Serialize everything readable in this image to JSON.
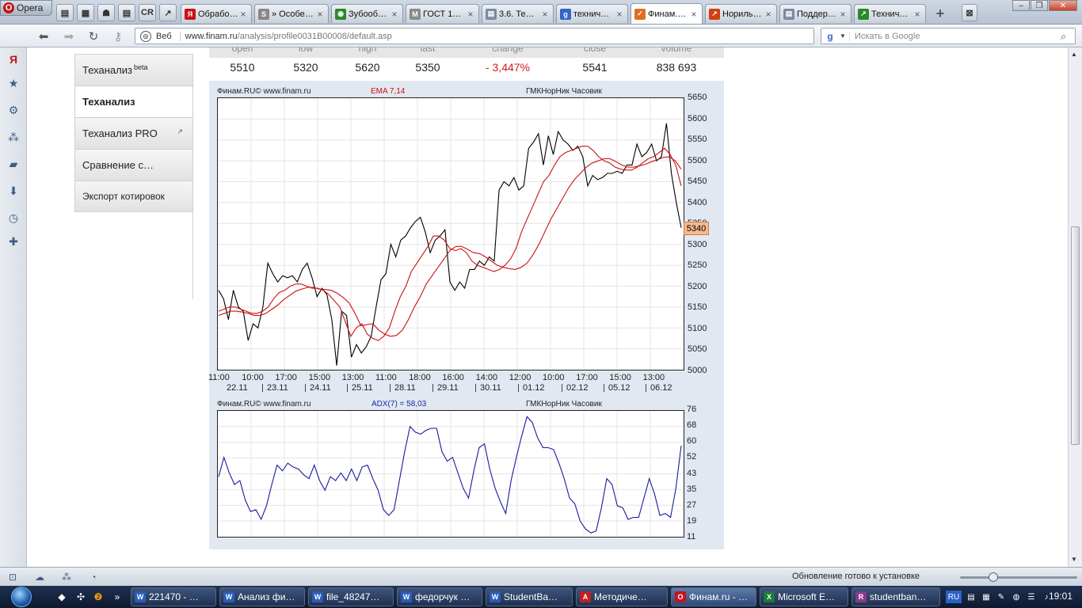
{
  "browser": {
    "menu_label": "Opera",
    "tabs": [
      {
        "title": "Обрабо…",
        "icon": "yandex-icon",
        "color": "#cc1111",
        "glyph": "Я"
      },
      {
        "title": "» Особе…",
        "icon": "sim-icon",
        "color": "#888888",
        "glyph": "S"
      },
      {
        "title": "Зубооб…",
        "icon": "globe-icon",
        "color": "#2a8a2a",
        "glyph": "◉"
      },
      {
        "title": "ГОСТ 1…",
        "icon": "m-icon",
        "color": "#8a8a8a",
        "glyph": "M"
      },
      {
        "title": "3.6. Те…",
        "icon": "page-icon",
        "color": "#7a8aa0",
        "glyph": "▤"
      },
      {
        "title": "технич…",
        "icon": "google-icon",
        "color": "#3366cc",
        "glyph": "g"
      },
      {
        "title": "Финам.…",
        "icon": "finam-icon",
        "color": "#e07020",
        "glyph": "✓"
      },
      {
        "title": "Нориль…",
        "icon": "chart-icon",
        "color": "#d04010",
        "glyph": "↗"
      },
      {
        "title": "Поддер…",
        "icon": "page-icon",
        "color": "#7a8aa0",
        "glyph": "▤"
      },
      {
        "title": "Технич…",
        "icon": "chart-icon",
        "color": "#2a8a2a",
        "glyph": "↗"
      }
    ],
    "active_tab": 6,
    "pinned_icons": [
      "page-icon",
      "panel-icon",
      "cat-icon",
      "page-icon",
      "cr-icon",
      "chart-icon"
    ],
    "address": {
      "scheme_label": "Веб",
      "url_host": "www.finam.ru",
      "url_path": "/analysis/profile0031B00008/default.asp"
    },
    "search": {
      "placeholder": "Искать в Google"
    }
  },
  "sidebar_menu": [
    {
      "label": "Теханализ",
      "sup": "beta",
      "selected": false
    },
    {
      "label": "Теханализ",
      "sup": "",
      "selected": true
    },
    {
      "label": "Теханализ PRO",
      "sup": "",
      "selected": false,
      "external": true
    },
    {
      "label": "Сравнение с…",
      "sup": "",
      "selected": false
    },
    {
      "label": "Экспорт котировок",
      "sup": "",
      "selected": false
    }
  ],
  "quote": {
    "headers": [
      "open",
      "low",
      "high",
      "last",
      "change",
      "close",
      "volume"
    ],
    "values": [
      "5510",
      "5320",
      "5620",
      "5350",
      "- 3,447%",
      "5541",
      "838 693"
    ]
  },
  "chart_data": [
    {
      "type": "line",
      "title_left": "Финам.RU© www.finam.ru",
      "indicator_label": "EMA 7,14",
      "instrument": "ГМКНорНик Часовик",
      "last_price_tag": "5340",
      "ylim": [
        5000,
        5650
      ],
      "yticks": [
        "5650",
        "5600",
        "5550",
        "5500",
        "5450",
        "5400",
        "5350",
        "5300",
        "5250",
        "5200",
        "5150",
        "5100",
        "5050",
        "5000"
      ],
      "xticks_time": [
        "11:00",
        "10:00",
        "17:00",
        "15:00",
        "13:00",
        "11:00",
        "18:00",
        "16:00",
        "14:00",
        "12:00",
        "10:00",
        "17:00",
        "15:00",
        "13:00"
      ],
      "xticks_date": [
        "22.11",
        "23.11",
        "24.11",
        "25.11",
        "28.11",
        "29.11",
        "30.11",
        "01.12",
        "02.12",
        "05.12",
        "06.12"
      ],
      "grid": true,
      "series": [
        {
          "name": "",
          "color": "#000000",
          "values": [
            5190,
            5170,
            5120,
            5190,
            5150,
            5140,
            5070,
            5110,
            5100,
            5150,
            5255,
            5230,
            5210,
            5225,
            5220,
            5225,
            5210,
            5240,
            5255,
            5220,
            5175,
            5195,
            5180,
            5120,
            5010,
            5140,
            5130,
            5030,
            5060,
            5040,
            5055,
            5080,
            5150,
            5215,
            5230,
            5300,
            5270,
            5310,
            5320,
            5340,
            5355,
            5365,
            5330,
            5280,
            5310,
            5320,
            5335,
            5210,
            5190,
            5210,
            5195,
            5240,
            5240,
            5260,
            5250,
            5270,
            5260,
            5430,
            5450,
            5440,
            5460,
            5430,
            5440,
            5530,
            5545,
            5565,
            5490,
            5560,
            5515,
            5570,
            5550,
            5540,
            5525,
            5535,
            5510,
            5440,
            5465,
            5455,
            5460,
            5470,
            5470,
            5475,
            5470,
            5490,
            5490,
            5540,
            5510,
            5520,
            5540,
            5500,
            5510,
            5590,
            5470,
            5400,
            5340
          ]
        },
        {
          "name": "EMA 7",
          "color": "#cc1111",
          "values": [
            5140,
            5145,
            5150,
            5150,
            5145,
            5140,
            5135,
            5135,
            5140,
            5150,
            5170,
            5185,
            5190,
            5200,
            5205,
            5205,
            5200,
            5195,
            5195,
            5190,
            5180,
            5165,
            5150,
            5115,
            5080,
            5100,
            5110,
            5085,
            5075,
            5070,
            5080,
            5100,
            5140,
            5175,
            5200,
            5235,
            5255,
            5275,
            5295,
            5320,
            5320,
            5310,
            5290,
            5285,
            5290,
            5280,
            5260,
            5250,
            5245,
            5240,
            5235,
            5240,
            5250,
            5265,
            5290,
            5330,
            5360,
            5390,
            5420,
            5450,
            5465,
            5490,
            5510,
            5520,
            5525,
            5530,
            5535,
            5535,
            5525,
            5510,
            5500,
            5495,
            5485,
            5480,
            5478,
            5478,
            5485,
            5495,
            5505,
            5510,
            5520,
            5530,
            5515,
            5490,
            5440
          ]
        },
        {
          "name": "EMA 14",
          "color": "#cc1111",
          "values": [
            5130,
            5135,
            5140,
            5140,
            5138,
            5135,
            5130,
            5130,
            5135,
            5145,
            5155,
            5168,
            5178,
            5188,
            5193,
            5197,
            5197,
            5193,
            5192,
            5190,
            5183,
            5173,
            5160,
            5135,
            5105,
            5108,
            5110,
            5095,
            5085,
            5080,
            5082,
            5095,
            5120,
            5150,
            5175,
            5205,
            5225,
            5245,
            5265,
            5285,
            5295,
            5295,
            5288,
            5280,
            5278,
            5270,
            5260,
            5250,
            5245,
            5242,
            5240,
            5245,
            5255,
            5275,
            5300,
            5330,
            5360,
            5385,
            5410,
            5435,
            5455,
            5470,
            5485,
            5495,
            5500,
            5505,
            5505,
            5498,
            5490,
            5485,
            5485,
            5488,
            5492,
            5498,
            5503,
            5508,
            5510,
            5500,
            5480
          ]
        }
      ]
    },
    {
      "type": "line",
      "title_left": "Финам.RU© www.finam.ru",
      "indicator_label": "ADX(7) = 58,03",
      "instrument": "ГМКНорНик Часовик",
      "ylim": [
        11,
        76
      ],
      "yticks": [
        "76",
        "68",
        "60",
        "52",
        "43",
        "35",
        "27",
        "19",
        "11"
      ],
      "grid": true,
      "series": [
        {
          "name": "ADX(7)",
          "color": "#1a1aa0",
          "values": [
            42,
            52,
            44,
            38,
            40,
            30,
            24,
            25,
            20,
            27,
            38,
            48,
            45,
            49,
            47,
            46,
            43,
            41,
            48,
            40,
            35,
            42,
            40,
            44,
            40,
            46,
            40,
            47,
            48,
            41,
            35,
            25,
            22,
            25,
            40,
            55,
            68,
            65,
            64,
            66,
            67,
            67,
            55,
            50,
            52,
            44,
            36,
            31,
            45,
            57,
            59,
            46,
            36,
            29,
            23,
            40,
            52,
            63,
            73,
            70,
            62,
            57,
            57,
            56,
            49,
            41,
            31,
            28,
            19,
            15,
            13,
            14,
            26,
            41,
            38,
            27,
            26,
            20,
            21,
            21,
            31,
            41,
            33,
            22,
            23,
            21,
            36,
            58
          ]
        }
      ]
    }
  ],
  "status": {
    "text": "Обновление готово к установке"
  },
  "taskbar": {
    "items": [
      {
        "label": "221470 - …",
        "icon": "word-icon",
        "color": "#2b5cb8"
      },
      {
        "label": "Анализ фи…",
        "icon": "word-icon",
        "color": "#2b5cb8"
      },
      {
        "label": "file_48247…",
        "icon": "word-icon",
        "color": "#2b5cb8"
      },
      {
        "label": "федорчук …",
        "icon": "word-icon",
        "color": "#2b5cb8"
      },
      {
        "label": "StudentBa…",
        "icon": "word-icon",
        "color": "#2b5cb8"
      },
      {
        "label": "Методиче…",
        "icon": "pdf-icon",
        "color": "#c02020"
      },
      {
        "label": "Финам.ru - …",
        "icon": "opera-icon",
        "color": "#c0161b"
      },
      {
        "label": "Microsoft E…",
        "icon": "excel-icon",
        "color": "#1d7a3a"
      },
      {
        "label": "studentban…",
        "icon": "winrar-icon",
        "color": "#8a3a8a"
      }
    ],
    "active_item": 6,
    "lang": "RU",
    "clock": "19:01"
  }
}
